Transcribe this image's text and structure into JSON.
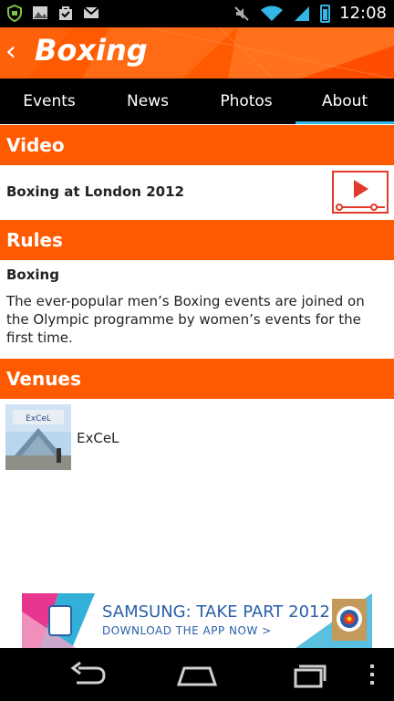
{
  "status_bar": {
    "time": "12:08",
    "left_icons": [
      "shield-icon",
      "image-icon",
      "bag-icon",
      "gmail-icon"
    ],
    "right_icons": [
      "mute-icon",
      "wifi-icon",
      "signal-icon",
      "battery-icon"
    ]
  },
  "app_bar": {
    "back_glyph": "‹",
    "title": "Boxing",
    "accent": "#ff5a00"
  },
  "tabs": [
    {
      "label": "Events",
      "active": false
    },
    {
      "label": "News",
      "active": false
    },
    {
      "label": "Photos",
      "active": false
    },
    {
      "label": "About",
      "active": true
    }
  ],
  "video": {
    "header": "Video",
    "title": "Boxing at London 2012",
    "icon": "video-play-icon"
  },
  "rules": {
    "header": "Rules",
    "subtitle": "Boxing",
    "body": "The ever-popular men’s Boxing events are joined on the Olympic programme by women’s events for the first time."
  },
  "venues": {
    "header": "Venues",
    "items": [
      {
        "name": "ExCeL",
        "sign_text": "ExCeL"
      }
    ]
  },
  "ad": {
    "line1": "SAMSUNG: TAKE PART 2012",
    "line2": "DOWNLOAD THE APP NOW >"
  },
  "nav_bar": {
    "icons": [
      "back-nav-icon",
      "home-nav-icon",
      "recents-nav-icon",
      "menu-nav-icon"
    ]
  }
}
